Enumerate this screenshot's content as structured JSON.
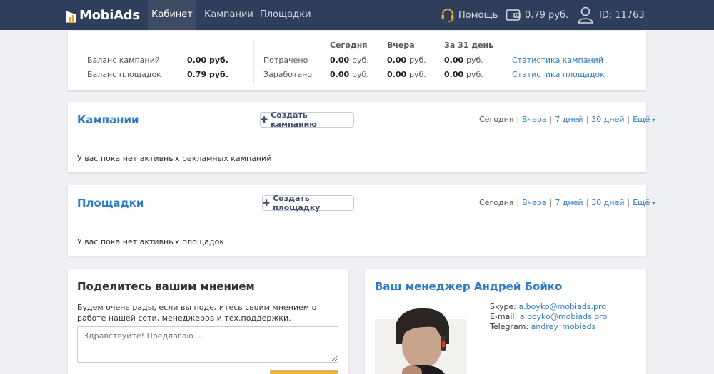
{
  "header": {
    "logo": "MobiAds",
    "nav": [
      "Кабинет",
      "Кампании",
      "Площадки"
    ],
    "help": "Помощь",
    "balance": "0.79 руб.",
    "user_id": "ID: 11763"
  },
  "stats": {
    "campaign_balance_label": "Баланс кампаний",
    "campaign_balance_value": "0.00 руб.",
    "sites_balance_label": "Баланс площадок",
    "sites_balance_value": "0.79 руб.",
    "col_today": "Сегодня",
    "col_yesterday": "Вчера",
    "col_31": "За 31 день",
    "spent_label": "Потрачено",
    "earned_label": "Заработано",
    "spent": [
      "0.00",
      "0.00",
      "0.00"
    ],
    "earned": [
      "0.00",
      "0.00",
      "0.00"
    ],
    "unit": "руб.",
    "campaign_stats_link": "Статистика кампаний",
    "sites_stats_link": "Статистика площадок"
  },
  "campaigns": {
    "title": "Кампании",
    "create_button": "Создать кампанию",
    "empty": "У вас пока нет активных рекламных кампаний"
  },
  "sites": {
    "title": "Площадки",
    "create_button": "Создать площадку",
    "empty": "У вас пока нет активных площадок"
  },
  "filters": {
    "today": "Сегодня",
    "yesterday": "Вчера",
    "days7": "7 дней",
    "days30": "30 дней",
    "more": "Ещё"
  },
  "feedback": {
    "title": "Поделитесь вашим мнением",
    "text": "Будем очень рады, если вы поделитесь своим мнением о работе нашей сети, менеджеров и тех.поддержки.",
    "placeholder": "Здравствуйте! Предлагаю ..."
  },
  "manager": {
    "title": "Ваш менеджер Андрей Бойко",
    "skype_label": "Skype:",
    "skype": "a.boyko@mobiads.pro",
    "email_label": "E-mail:",
    "email": "a.boyko@mobiads.pro",
    "telegram_label": "Telegram:",
    "telegram": "andrey_mobiads"
  },
  "colors": {
    "nav_bg": "#2f3f5b",
    "accent": "#2f7bc4",
    "help_icon": "#e8a23a",
    "submit_button": "#e8b24a"
  }
}
